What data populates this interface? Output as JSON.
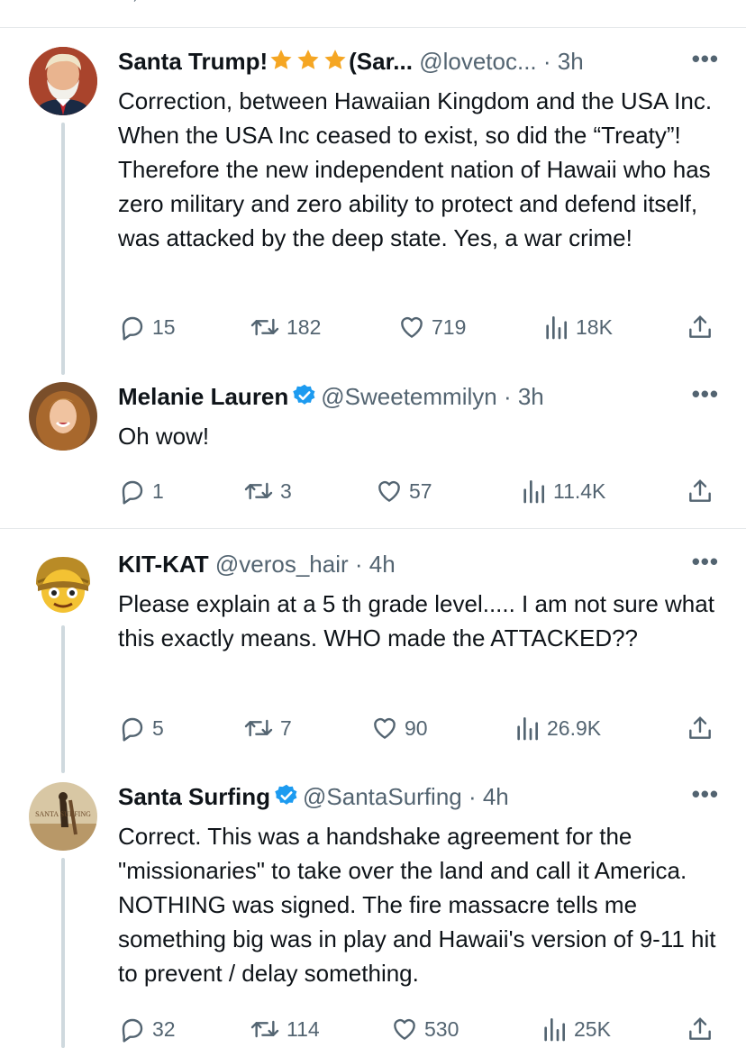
{
  "colors": {
    "icon_gray": "#536471",
    "verified_blue": "#1d9bf0",
    "star_gold": "#f5a623",
    "thread_line": "#cfd9de"
  },
  "tweets": [
    {
      "name": "Santa Trump!",
      "name_suffix": "(Sar...",
      "verified": false,
      "handle": "@lovetoc...",
      "time": "· 3h",
      "text": "Correction, between Hawaiian Kingdom and the USA Inc. When the USA Inc ceased to exist, so did the “Treaty”! Therefore the new independent nation of Hawaii who has zero military and zero ability to protect and defend itself, was attacked by the deep state. Yes, a war crime!",
      "replies": "15",
      "retweets": "182",
      "likes": "719",
      "views": "18K"
    },
    {
      "name": "Melanie Lauren",
      "verified": true,
      "handle": "@Sweetemmilyn",
      "time": "· 3h",
      "text": "Oh wow!",
      "replies": "1",
      "retweets": "3",
      "likes": "57",
      "views": "11.4K"
    },
    {
      "name": "KIT-KAT",
      "verified": false,
      "handle": "@veros_hair",
      "time": "· 4h",
      "text": "Please explain at a 5 th grade level..... I am not sure what this exactly means. WHO made the ATTACKED??",
      "replies": "5",
      "retweets": "7",
      "likes": "90",
      "views": "26.9K"
    },
    {
      "name": "Santa Surfing",
      "verified": true,
      "handle": "@SantaSurfing",
      "time": "· 4h",
      "text": "Correct.  This was a handshake agreement for the \"missionaries\" to take over the land and call it America.  NOTHING was signed.  The fire massacre tells me something big was in play and Hawaii's version of 9-11 hit to prevent / delay something.",
      "replies": "32",
      "retweets": "114",
      "likes": "530",
      "views": "25K",
      "avatar_text": "SANTA SURFING"
    }
  ]
}
